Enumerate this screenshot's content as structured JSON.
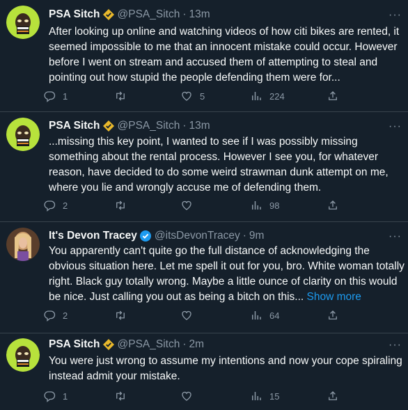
{
  "colors": {
    "background": "#15202b",
    "text": "#f7f9f9",
    "secondary": "#8b98a5",
    "link": "#1d9bf0",
    "divider": "#38444d",
    "gold_badge": "#e8b82c",
    "blue_badge": "#1d9bf0"
  },
  "icons": {
    "reply": "reply-icon",
    "retweet": "retweet-icon",
    "like": "heart-icon",
    "views": "views-icon",
    "share": "share-icon",
    "more": "more-icon",
    "verified_gold": "gold-verified-icon",
    "verified_blue": "blue-verified-icon"
  },
  "more_glyph": "···",
  "dot": "·",
  "tweets": [
    {
      "name": "PSA Sitch",
      "handle": "@PSA_Sitch",
      "time": "13m",
      "text": "After looking up online and watching videos of how citi bikes are rented, it seemed impossible to me that an innocent mistake could occur. However before I went on stream and accused them of attempting to steal and pointing out how stupid the people defending them were for...",
      "show_more": "",
      "stats": {
        "replies": "1",
        "retweets": "",
        "likes": "5",
        "views": "224"
      }
    },
    {
      "name": "PSA Sitch",
      "handle": "@PSA_Sitch",
      "time": "13m",
      "text": "...missing this key point, I wanted to see if I was possibly missing something about the rental process. However I see you, for whatever reason, have decided to do some weird strawman dunk attempt on me, where you lie and wrongly accuse me of defending them.",
      "show_more": "",
      "stats": {
        "replies": "2",
        "retweets": "",
        "likes": "",
        "views": "98"
      }
    },
    {
      "name": "It's Devon Tracey",
      "handle": "@itsDevonTracey",
      "time": "9m",
      "text": "You apparently can't quite go the full distance of acknowledging the obvious situation here. Let me spell it out for you, bro. White woman totally right. Black guy totally wrong. Maybe a little ounce of clarity on this would be nice. Just calling you out as being a bitch on this...",
      "show_more": "Show more",
      "stats": {
        "replies": "2",
        "retweets": "",
        "likes": "",
        "views": "64"
      }
    },
    {
      "name": "PSA Sitch",
      "handle": "@PSA_Sitch",
      "time": "2m",
      "text": "You were just wrong to assume my intentions and now your cope spiraling instead admit your mistake.",
      "show_more": "",
      "stats": {
        "replies": "1",
        "retweets": "",
        "likes": "",
        "views": "15"
      }
    }
  ]
}
